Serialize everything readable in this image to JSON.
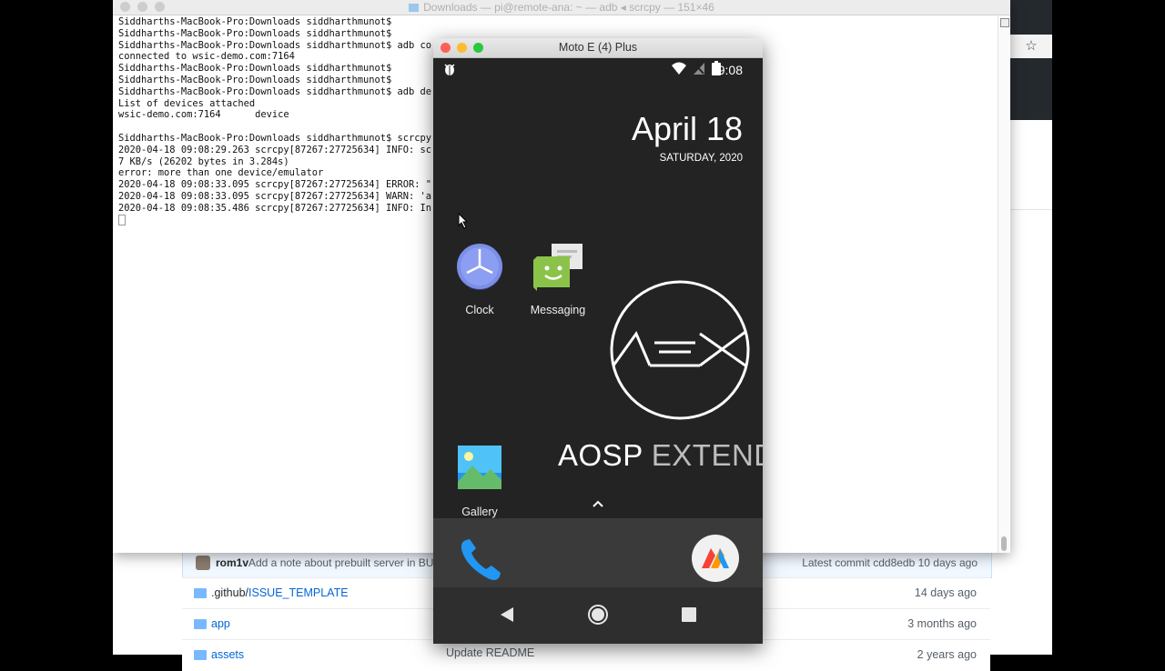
{
  "terminal": {
    "title": "Downloads — pi@remote-ana: ~ — adb ◂ scrcpy — 151×46",
    "lines": [
      "Siddharths-MacBook-Pro:Downloads siddharthmunot$",
      "Siddharths-MacBook-Pro:Downloads siddharthmunot$",
      "Siddharths-MacBook-Pro:Downloads siddharthmunot$ adb co",
      "connected to wsic-demo.com:7164",
      "Siddharths-MacBook-Pro:Downloads siddharthmunot$",
      "Siddharths-MacBook-Pro:Downloads siddharthmunot$",
      "Siddharths-MacBook-Pro:Downloads siddharthmunot$ adb de",
      "List of devices attached",
      "wsic-demo.com:7164      device",
      "",
      "Siddharths-MacBook-Pro:Downloads siddharthmunot$ scrcpy",
      "2020-04-18 09:08:29.263 scrcpy[87267:27725634] INFO: sc",
      "7 KB/s (26202 bytes in 3.284s)",
      "error: more than one device/emulator",
      "2020-04-18 09:08:33.095 scrcpy[87267:27725634] ERROR: \"",
      "2020-04-18 09:08:33.095 scrcpy[87267:27725634] WARN: 'a",
      "2020-04-18 09:08:35.486 scrcpy[87267:27725634] INFO: In"
    ]
  },
  "scrcpy": {
    "title": "Moto E (4) Plus"
  },
  "android": {
    "status_time": "9:08",
    "date_big": "April 18",
    "date_small": "SATURDAY, 2020",
    "apps": {
      "clock": "Clock",
      "messaging": "Messaging",
      "gallery": "Gallery"
    },
    "aosp_left": "AOSP",
    "aosp_right": "EXTENDED"
  },
  "github": {
    "commit_author": "rom1v",
    "commit_message": "Add a note about prebuilt server in BUIL",
    "latest_commit": "Latest commit cdd8edb 10 days ago",
    "rows": [
      {
        "prefix": ".github/",
        "name": "ISSUE_TEMPLATE",
        "time": "14 days ago"
      },
      {
        "prefix": "",
        "name": "app",
        "time": "3 months ago"
      },
      {
        "prefix": "",
        "name": "assets",
        "time": "2 years ago"
      }
    ],
    "update_readme": "Update README"
  },
  "colors": {
    "close": "#fe5f57",
    "minimize": "#febc2e",
    "zoom": "#28c840",
    "link": "#0366d6"
  }
}
